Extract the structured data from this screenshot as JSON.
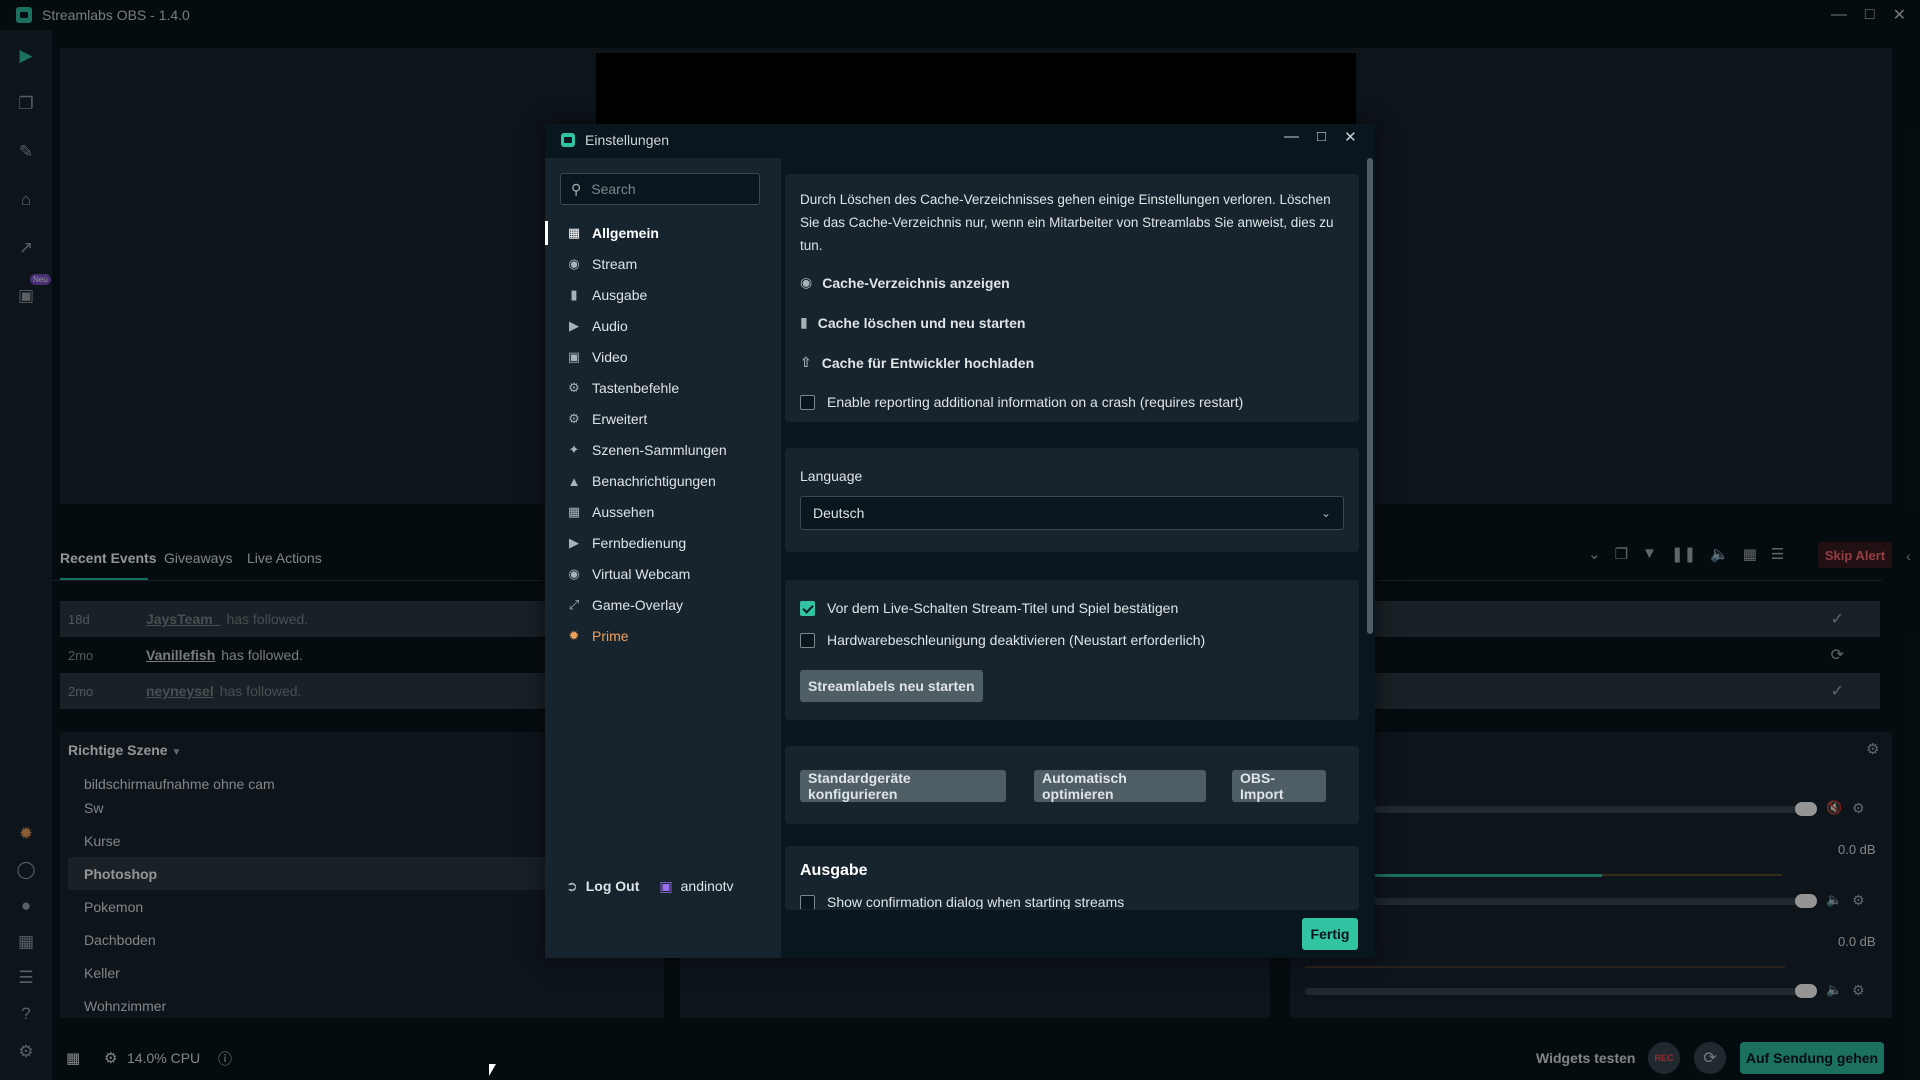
{
  "app": {
    "title": "Streamlabs OBS - 1.4.0"
  },
  "nav": {
    "new_badge": "Neu"
  },
  "events": {
    "tabs": [
      "Recent Events",
      "Giveaways",
      "Live Actions"
    ],
    "rows": [
      {
        "age": "18d",
        "name": "JaysTeam_",
        "text": "has followed."
      },
      {
        "age": "2mo",
        "name": "Vanillefish",
        "text": "has followed."
      },
      {
        "age": "2mo",
        "name": "neyneysel",
        "text": "has followed."
      }
    ],
    "skip_alert": "Skip Alert"
  },
  "scenes": {
    "header": "Richtige Szene",
    "items": [
      "bildschirmaufnahme ohne cam",
      "Sw",
      "Kurse",
      "Photoshop",
      "Pokemon",
      "Dachboden",
      "Keller",
      "Wohnzimmer"
    ]
  },
  "mixer": {
    "db1": "0.0 dB",
    "db2": "0.0 dB"
  },
  "status": {
    "cpu": "14.0% CPU",
    "widgets": "Widgets testen",
    "rec": "REC",
    "go_live": "Auf Sendung gehen"
  },
  "settings": {
    "title": "Einstellungen",
    "search_placeholder": "Search",
    "menu": [
      "Allgemein",
      "Stream",
      "Ausgabe",
      "Audio",
      "Video",
      "Tastenbefehle",
      "Erweitert",
      "Szenen-Sammlungen",
      "Benachrichtigungen",
      "Aussehen",
      "Fernbedienung",
      "Virtual Webcam",
      "Game-Overlay",
      "Prime"
    ],
    "logout": "Log Out",
    "user": "andinotv",
    "cache_text": "Durch Löschen des Cache-Verzeichnisses gehen einige Einstellungen verloren. Löschen Sie das Cache-Verzeichnis nur, wenn ein Mitarbeiter von Streamlabs Sie anweist, dies zu tun.",
    "cache_show": "Cache-Verzeichnis anzeigen",
    "cache_clear": "Cache löschen und neu starten",
    "cache_upload": "Cache für Entwickler hochladen",
    "crash_report": "Enable reporting additional information on a crash (requires restart)",
    "language_label": "Language",
    "language_value": "Deutsch",
    "confirm_title": "Vor dem Live-Schalten Stream-Titel und Spiel bestätigen",
    "disable_hw": "Hardwarebeschleunigung deaktivieren (Neustart erforderlich)",
    "restart_streamlabels": "Streamlabels neu starten",
    "btn_defaults": "Standardgeräte konfigurieren",
    "btn_optimize": "Automatisch optimieren",
    "btn_obs_import": "OBS-Import",
    "ausgabe_heading": "Ausgabe",
    "confirm_dialog": "Show confirmation dialog when starting streams",
    "done": "Fertig"
  },
  "colors": {
    "accent": "#31c3a2",
    "prime": "#f0a15a",
    "alert": "#ff6a73"
  }
}
